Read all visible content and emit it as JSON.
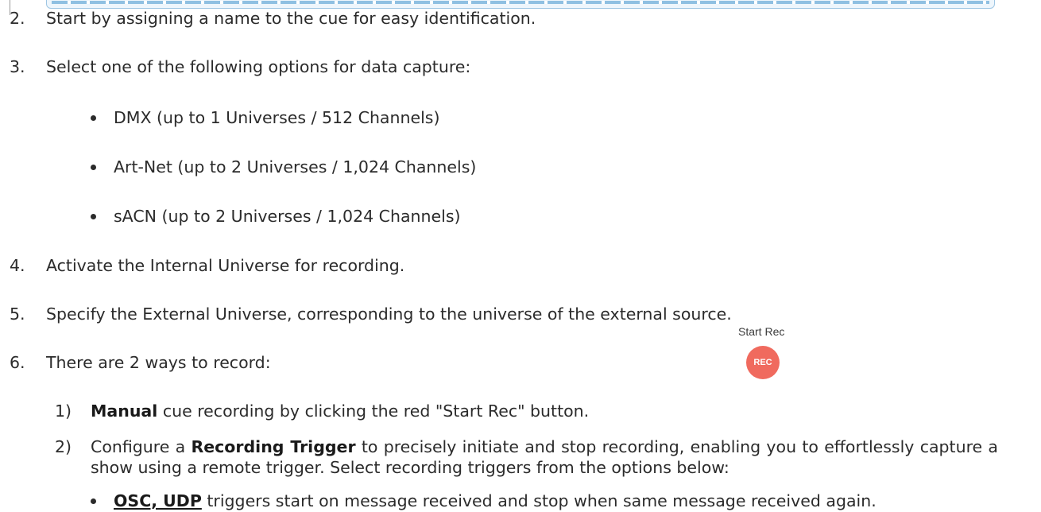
{
  "steps": {
    "s2": {
      "num": "2.",
      "text": "Start by assigning a name to the cue for easy identification."
    },
    "s3": {
      "num": "3.",
      "text": "Select one of the following options for data capture:"
    },
    "options": [
      "DMX (up to 1 Universes / 512 Channels)",
      "Art-Net (up to 2 Universes / 1,024 Channels)",
      "sACN (up to 2 Universes / 1,024 Channels)"
    ],
    "s4": {
      "num": "4.",
      "text": "Activate the Internal Universe for recording."
    },
    "s5": {
      "num": "5.",
      "text": "Specify the External Universe, corresponding to the universe of the external source."
    },
    "s6": {
      "num": "6.",
      "text": "There are 2 ways to record:"
    },
    "sub1": {
      "num": "1)",
      "bold": "Manual",
      "text": " cue recording by clicking the red \"Start Rec\" button."
    },
    "sub2": {
      "num": "2)",
      "pre": "Configure a ",
      "bold": "Recording Trigger",
      "post": " to precisely initiate and stop recording, enabling you to effortlessly capture a show using a remote trigger. Select recording triggers from the options below:"
    },
    "trigger_bullet": {
      "bold": "OSC, UDP",
      "text": " triggers start on message received and stop when same message received again."
    }
  },
  "start_rec": {
    "label": "Start Rec",
    "button_text": "REC",
    "color": "#f06a5e"
  }
}
